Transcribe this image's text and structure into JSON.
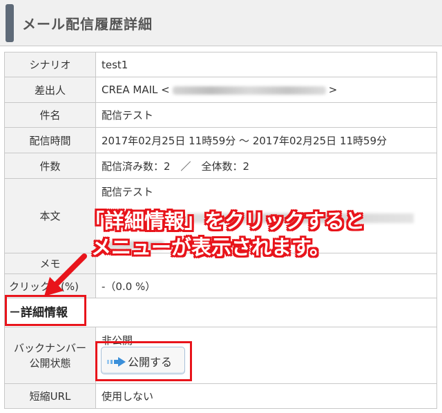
{
  "header": {
    "title": "メール配信履歴詳細"
  },
  "rows": {
    "scenario": {
      "label": "シナリオ",
      "value": "test1"
    },
    "sender": {
      "label": "差出人",
      "name": "CREA MAIL <",
      "close": ">"
    },
    "subject": {
      "label": "件名",
      "value": "配信テスト"
    },
    "sent_time": {
      "label": "配信時間",
      "value": "2017年02月25日 11時59分 〜 2017年02月25日 11時59分"
    },
    "count": {
      "label": "件数",
      "value": "配信済み数：2　／　全体数：2"
    },
    "body": {
      "label": "本文",
      "value": "配信テスト"
    },
    "memo": {
      "label": "メモ",
      "value": ""
    },
    "click": {
      "label": "クリック率(%)",
      "value": "-（0.0 %）"
    },
    "details_toggle": {
      "label": "－詳細情報"
    },
    "backnumber": {
      "label_line1": "バックナンバー",
      "label_line2": "公開状態",
      "status": "非公開",
      "button_label": "公開する"
    },
    "short_url": {
      "label": "短縮URL",
      "value": "使用しない"
    }
  },
  "annotation": {
    "line1": "「詳細情報」をクリックすると",
    "line2": "メニューが表示されます。"
  },
  "colors": {
    "accent_red": "#e8141b",
    "header_bar": "#5e6a78",
    "label_bg": "#f2f2f2",
    "button_arrow": "#3b8fd9"
  },
  "icons": {
    "publish_button_icon": "arrow-right-icon",
    "callout_icon": "red-arrow-icon"
  }
}
